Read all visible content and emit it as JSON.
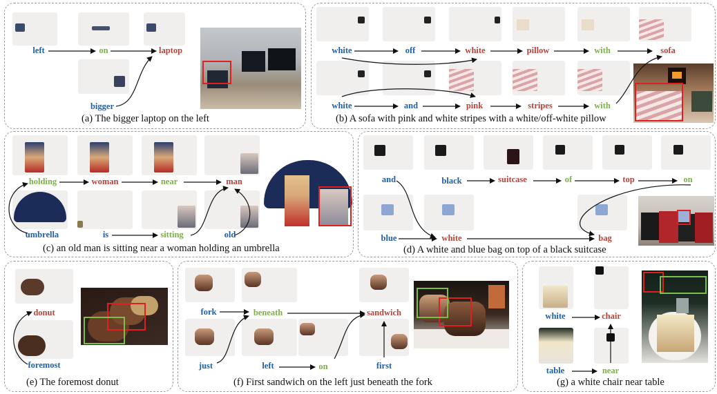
{
  "panels": {
    "a": {
      "caption": "(a) The bigger laptop on the left",
      "words": [
        {
          "text": "left",
          "color": "blue"
        },
        {
          "text": "on",
          "color": "green"
        },
        {
          "text": "laptop",
          "color": "red"
        },
        {
          "text": "bigger",
          "color": "blue"
        }
      ]
    },
    "b": {
      "caption": "(b) A sofa with pink and white stripes with a white/off-white pillow",
      "words": [
        {
          "text": "white",
          "color": "blue"
        },
        {
          "text": "off",
          "color": "blue"
        },
        {
          "text": "white",
          "color": "red"
        },
        {
          "text": "pillow",
          "color": "red"
        },
        {
          "text": "with",
          "color": "green"
        },
        {
          "text": "sofa",
          "color": "red"
        },
        {
          "text": "white",
          "color": "blue"
        },
        {
          "text": "and",
          "color": "blue"
        },
        {
          "text": "pink",
          "color": "red"
        },
        {
          "text": "stripes",
          "color": "red"
        },
        {
          "text": "with",
          "color": "green"
        }
      ]
    },
    "c": {
      "caption": "(c) an old man is sitting near a woman holding an umbrella",
      "words": [
        {
          "text": "holding",
          "color": "green"
        },
        {
          "text": "woman",
          "color": "red"
        },
        {
          "text": "near",
          "color": "green"
        },
        {
          "text": "man",
          "color": "red"
        },
        {
          "text": "umbrella",
          "color": "blue"
        },
        {
          "text": "is",
          "color": "blue"
        },
        {
          "text": "sitting",
          "color": "green"
        },
        {
          "text": "old",
          "color": "blue"
        }
      ]
    },
    "d": {
      "caption": "(d) A white and blue bag on top of a black suitcase",
      "words": [
        {
          "text": "and",
          "color": "blue"
        },
        {
          "text": "black",
          "color": "blue"
        },
        {
          "text": "suitcase",
          "color": "red"
        },
        {
          "text": "of",
          "color": "green"
        },
        {
          "text": "top",
          "color": "red"
        },
        {
          "text": "on",
          "color": "green"
        },
        {
          "text": "blue",
          "color": "blue"
        },
        {
          "text": "white",
          "color": "red"
        },
        {
          "text": "bag",
          "color": "red"
        }
      ]
    },
    "e": {
      "caption": "(e) The foremost donut",
      "words": [
        {
          "text": "donut",
          "color": "red"
        },
        {
          "text": "foremost",
          "color": "blue"
        }
      ]
    },
    "f": {
      "caption": "(f) First sandwich on the left just beneath the fork",
      "words": [
        {
          "text": "fork",
          "color": "blue"
        },
        {
          "text": "beneath",
          "color": "green"
        },
        {
          "text": "sandwich",
          "color": "red"
        },
        {
          "text": "just",
          "color": "blue"
        },
        {
          "text": "left",
          "color": "blue"
        },
        {
          "text": "on",
          "color": "green"
        },
        {
          "text": "first",
          "color": "blue"
        }
      ]
    },
    "g": {
      "caption": "(g) a white chair near table",
      "words": [
        {
          "text": "white",
          "color": "blue"
        },
        {
          "text": "chair",
          "color": "red"
        },
        {
          "text": "table",
          "color": "blue"
        },
        {
          "text": "near",
          "color": "green"
        }
      ]
    }
  },
  "colors": {
    "modifier": "#1f5fa8",
    "object": "#b7443a",
    "relation": "#7db04a",
    "target_box": "#e02020",
    "secondary_box": "#7cc04a"
  }
}
